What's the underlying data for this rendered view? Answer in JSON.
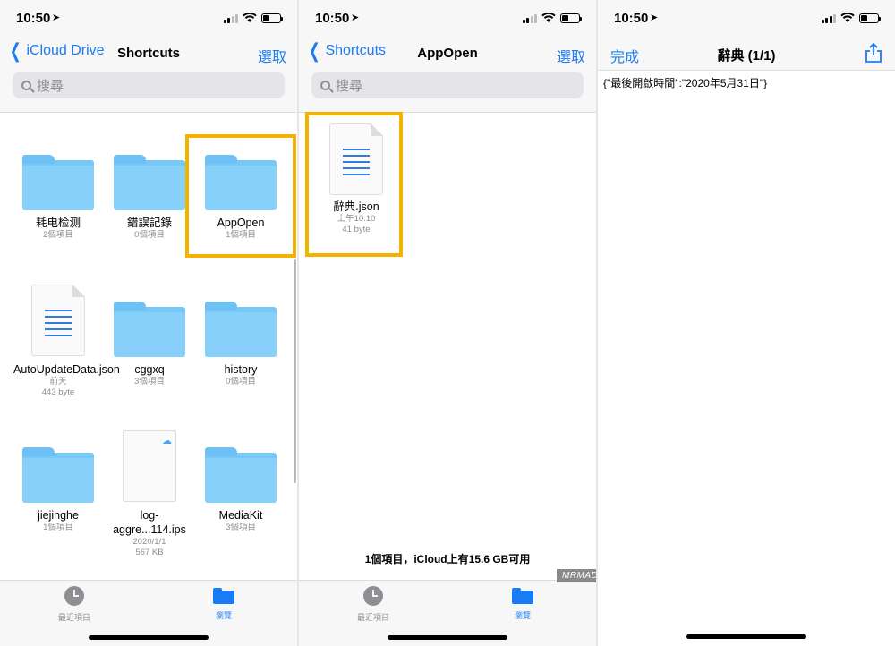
{
  "status": {
    "time": "10:50"
  },
  "panel1": {
    "back_label": "iCloud Drive",
    "title": "Shortcuts",
    "action": "選取",
    "search_placeholder": "搜尋",
    "items": [
      {
        "type": "folder",
        "name": "耗电检测",
        "meta": "2個項目"
      },
      {
        "type": "folder",
        "name": "錯誤記錄",
        "meta": "0個項目"
      },
      {
        "type": "folder",
        "name": "AppOpen",
        "meta": "1個項目"
      },
      {
        "type": "doc",
        "name": "AutoUpdateData.json",
        "meta": "前天",
        "meta2": "443 byte"
      },
      {
        "type": "folder",
        "name": "cggxq",
        "meta": "3個項目"
      },
      {
        "type": "folder",
        "name": "history",
        "meta": "0個項目"
      },
      {
        "type": "folder",
        "name": "jiejinghe",
        "meta": "1個項目"
      },
      {
        "type": "blank",
        "name": "log-aggre...114.ips",
        "meta": "2020/1/1",
        "meta2": "567 KB"
      },
      {
        "type": "folder",
        "name": "MediaKit",
        "meta": "3個項目"
      }
    ]
  },
  "panel2": {
    "back_label": "Shortcuts",
    "title": "AppOpen",
    "action": "選取",
    "search_placeholder": "搜尋",
    "file": {
      "name": "辭典.json",
      "meta": "上午10:10",
      "meta2": "41 byte"
    },
    "storage": "1個項目，iCloud上有15.6 GB可用"
  },
  "panel3": {
    "left_action": "完成",
    "title": "辭典 (1/1)",
    "content": "{\"最後開啟時間\":\"2020年5月31日\"}"
  },
  "tabbar": {
    "recent": "最近項目",
    "browse": "瀏覽"
  },
  "watermark": "MRMAD.COM.TW",
  "colors": {
    "accent": "#1a7cf5",
    "highlight": "#f4b300",
    "folder": "#76c8f7"
  }
}
